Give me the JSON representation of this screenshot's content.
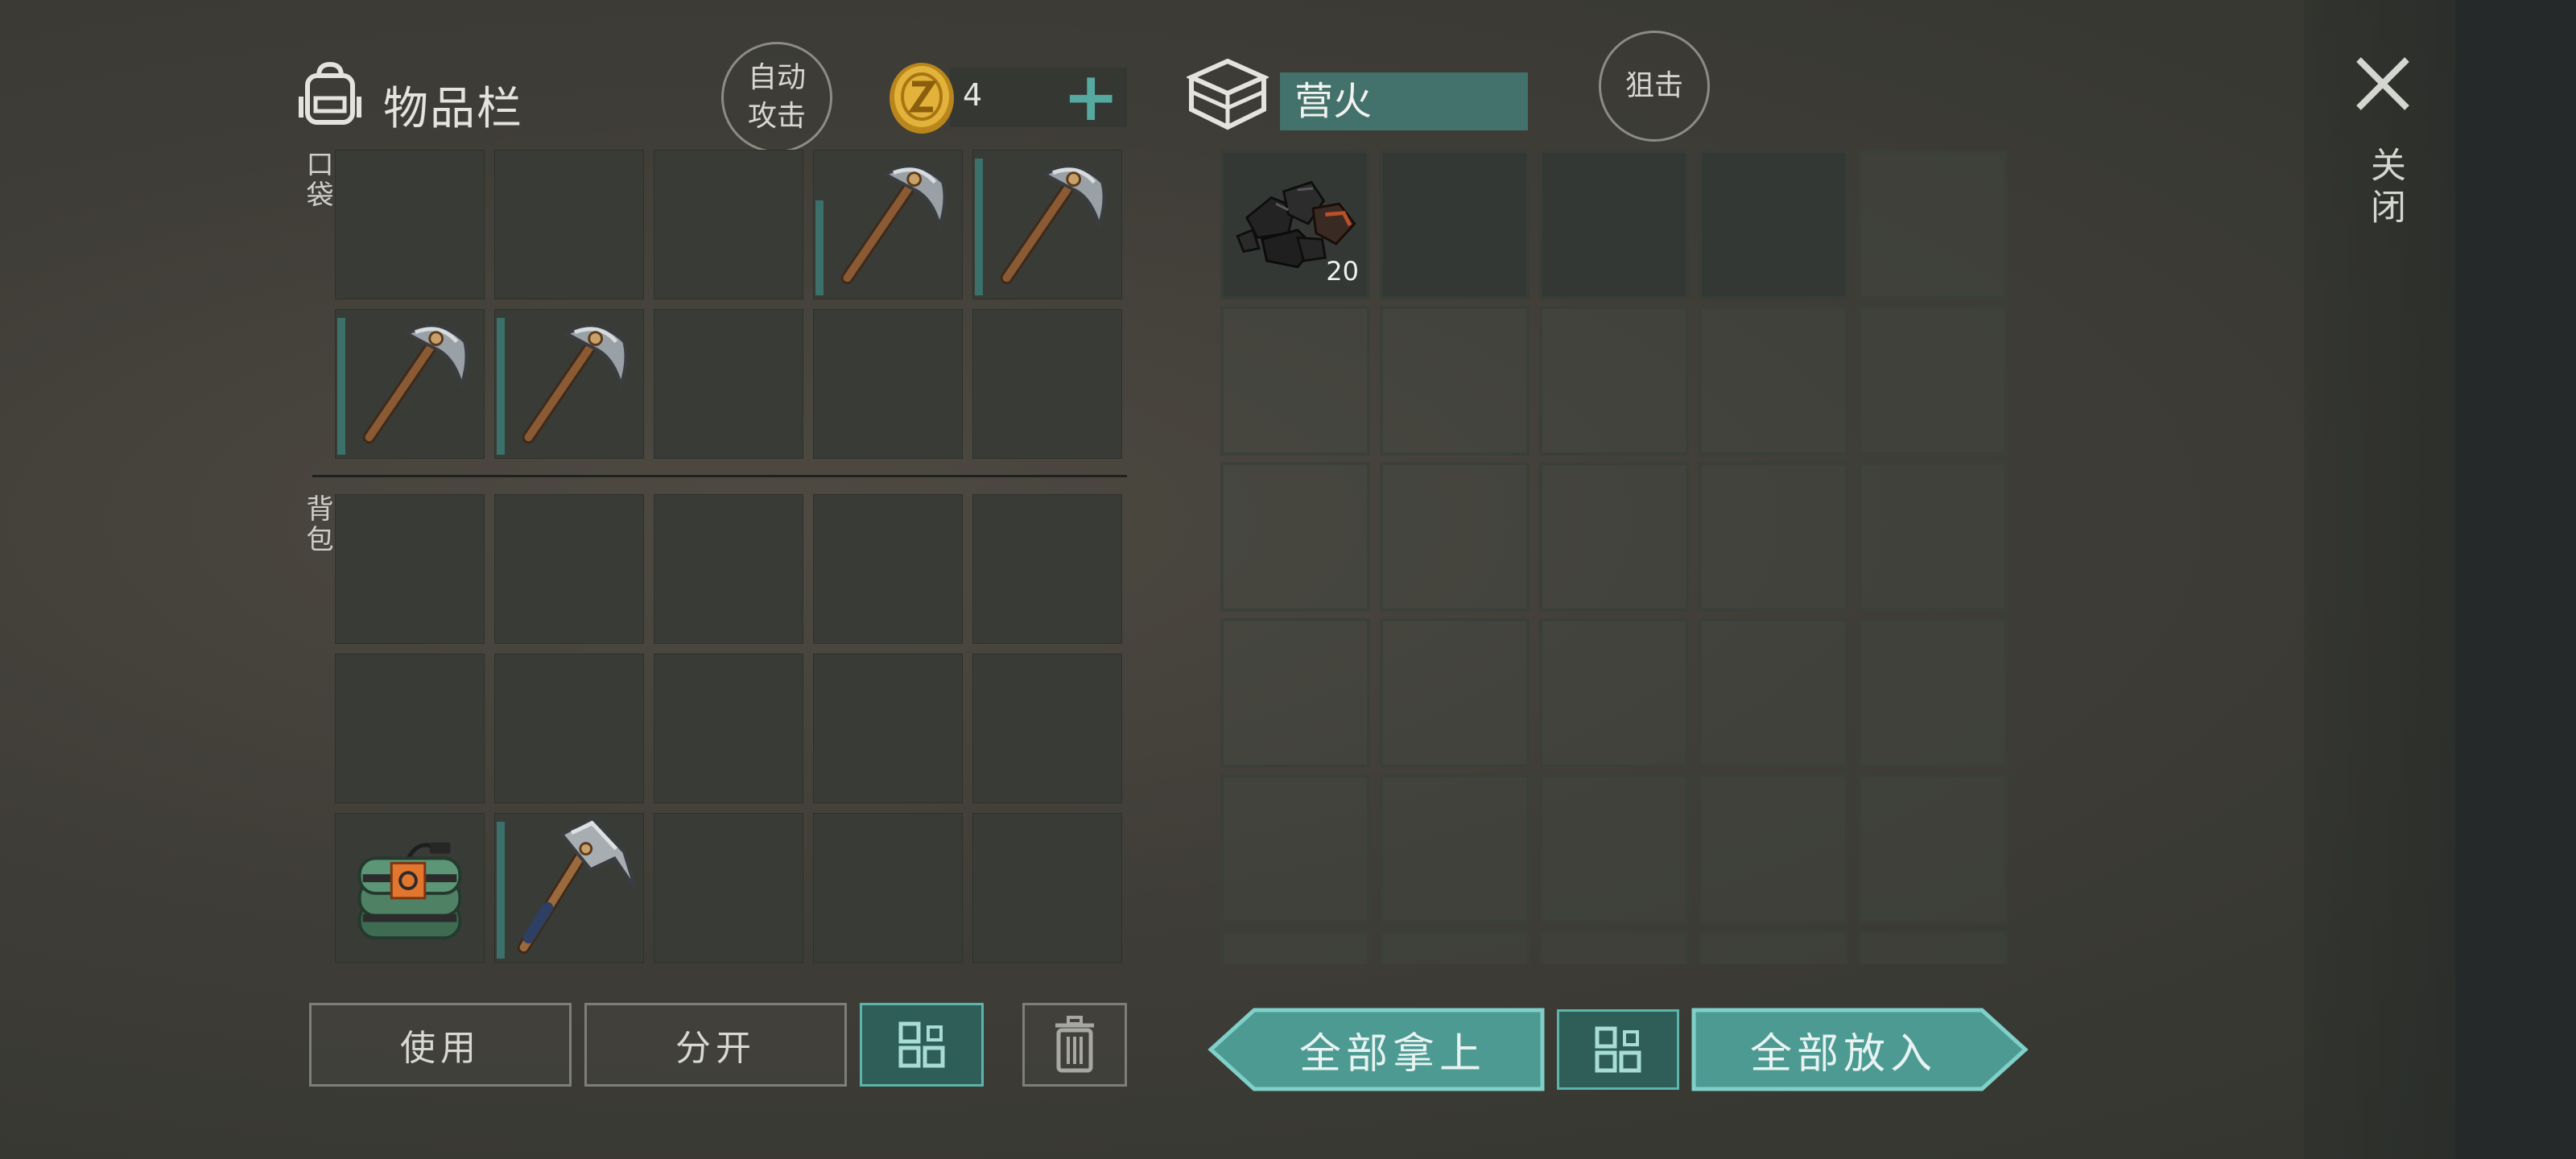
{
  "header": {
    "inventory_title": "物品栏",
    "auto_attack": "自动\n攻击",
    "coins": "4",
    "container_title": "营火",
    "snipe": "狙击",
    "close_label": "关闭"
  },
  "labels": {
    "pocket": "口袋",
    "backpack": "背包"
  },
  "inventory": {
    "pocket_items": [
      "",
      "",
      "",
      "pickaxe",
      "pickaxe",
      "pickaxe",
      "pickaxe",
      "",
      "",
      ""
    ],
    "backpack_items": [
      "",
      "",
      "",
      "",
      "",
      "",
      "",
      "",
      "",
      "",
      "dynamite-bundle",
      "hammer",
      "",
      "",
      ""
    ]
  },
  "container": {
    "first_item": "coal",
    "first_item_quantity": "20"
  },
  "actions": {
    "use": "使用",
    "split": "分开",
    "take_all": "全部拿上",
    "put_all": "全部放入"
  },
  "colors": {
    "accent": "#5cb5ab",
    "accent_dark": "#2f5d58",
    "field": "#43716b"
  }
}
